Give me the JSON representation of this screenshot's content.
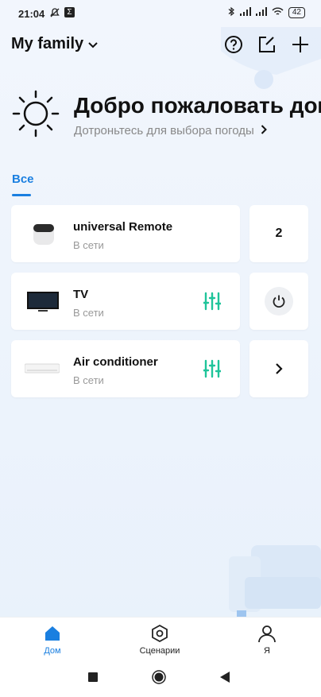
{
  "status_bar": {
    "time": "21:04",
    "battery": "42"
  },
  "header": {
    "family_label": "My family"
  },
  "welcome": {
    "title": "Добро пожаловать домой",
    "hint": "Дотроньтесь для выбора погоды"
  },
  "tabs": [
    {
      "label": "Все",
      "active": true
    }
  ],
  "devices": [
    {
      "name": "universal Remote",
      "status": "В сети",
      "side_value": "2"
    },
    {
      "name": "TV",
      "status": "В сети"
    },
    {
      "name": "Air conditioner",
      "status": "В сети"
    }
  ],
  "nav": {
    "home": "Дом",
    "scenes": "Сценарии",
    "me": "Я"
  },
  "colors": {
    "accent": "#1a7fe0",
    "control_green": "#1fc49a"
  }
}
